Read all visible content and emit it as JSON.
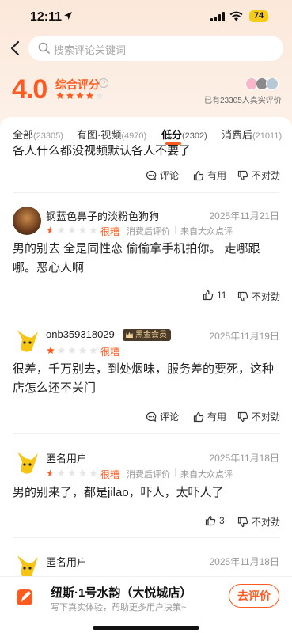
{
  "status_bar": {
    "time": "12:11",
    "battery": "74"
  },
  "search": {
    "placeholder": "搜索评论关键词"
  },
  "summary": {
    "score": "4.0",
    "score_label": "综合评分",
    "score_stars": 4,
    "real_review_count_text": "已有23305人真实评价"
  },
  "tabs": [
    {
      "label": "全部",
      "count": "(23305)",
      "active": false
    },
    {
      "label": "有图·视频",
      "count": "(4970)",
      "active": false
    },
    {
      "label": "低分",
      "count": "(2302)",
      "active": true
    },
    {
      "label": "消费后",
      "count": "(21011)",
      "active": false
    }
  ],
  "clipped_review_text": "各人什么都没视频默认各人不要了",
  "actions": {
    "comment": "评论",
    "useful": "有用",
    "not_right": "不对劲"
  },
  "reviews": [
    {
      "user": "钢蓝色鼻子的淡粉色狗狗",
      "date": "2025年11月21日",
      "stars": 0.5,
      "rating_word": "很糟",
      "meta1": "消费后评价",
      "meta2": "来自大众点评",
      "text": "男的别去 全是同性恋 偷偷拿手机拍你。 走哪跟哪。恶心人啊",
      "likes": "11"
    },
    {
      "user": "onb359318029",
      "badge": "黑金会员",
      "date": "2025年11月19日",
      "stars": 1,
      "rating_word": "很糟",
      "text": "很差，千万别去，到处烟味，服务差的要死，这种店怎么还不关门"
    },
    {
      "user": "匿名用户",
      "date": "2025年11月18日",
      "stars": 0.5,
      "rating_word": "很糟",
      "meta1": "消费后评价",
      "meta2": "来自大众点评",
      "text": "男的别来了，都是jilao，吓人，太吓人了",
      "likes": "3"
    },
    {
      "user": "匿名用户",
      "date": "2025年11月18日"
    }
  ],
  "bottom_bar": {
    "shop_name": "纽斯·1号水韵（大悦城店）",
    "hint": "写下真实体验，帮助更多用户决策~",
    "write_button": "去评价"
  },
  "colors": {
    "accent": "#ff5a1f",
    "badge_bg": "#4a3a2a"
  }
}
